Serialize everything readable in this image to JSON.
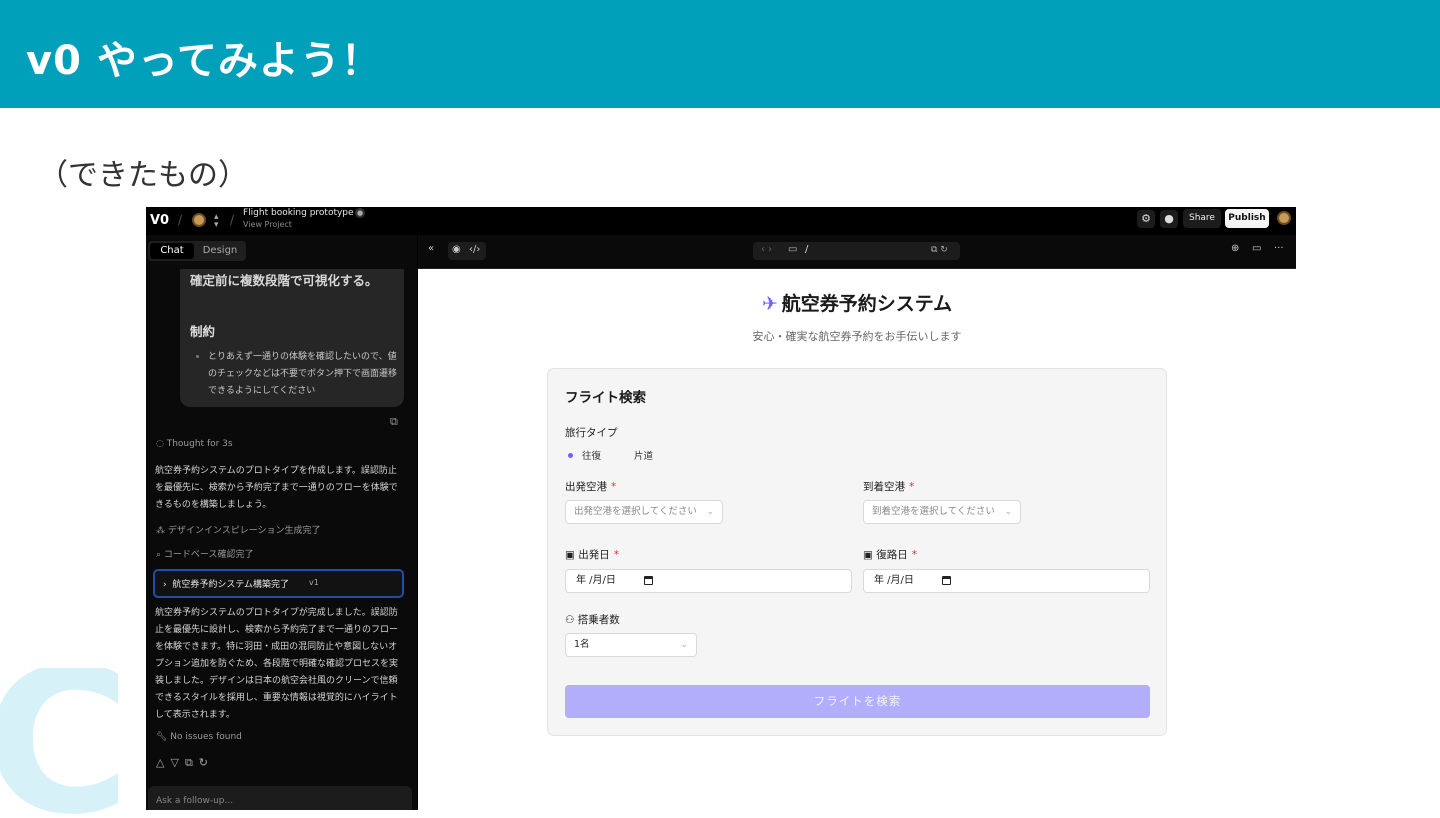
{
  "slide": {
    "title": "v0 やってみよう！",
    "subtitle": "（できたもの）",
    "bg_logo": "C"
  },
  "topbar": {
    "logo": "V0",
    "project_title": "Flight booking prototype",
    "project_link": "View Project",
    "share_label": "Share",
    "publish_label": "Publish",
    "icons": [
      "settings-icon",
      "github-icon"
    ]
  },
  "chat": {
    "tabs": [
      "Chat",
      "Design"
    ],
    "bubble": {
      "heading_tail": "確定前に複数段階で可視化する。",
      "constraints_heading": "制約",
      "constraint_item": "とりあえず一通りの体験を確認したいので、値のチェックなどは不要でボタン押下で画面遷移できるようにしてください"
    },
    "thought": "Thought for 3s",
    "intro": "航空券予約システムのプロトタイプを作成します。誤認防止を最優先に、検索から予約完了まで一通りのフローを体験できるものを構築しましょう。",
    "steps": [
      "デザインインスピレーション生成完了",
      "コードベース確認完了"
    ],
    "version_label": "航空券予約システム構築完了",
    "version_badge": "v1",
    "summary": "航空券予約システムのプロトタイプが完成しました。誤認防止を最優先に設計し、検索から予約完了まで一通りのフローを体験できます。特に羽田・成田の混同防止や意図しないオプション追加を防ぐため、各段階で明確な確認プロセスを実装しました。デザインは日本の航空会社風のクリーンで信頼できるスタイルを採用し、重要な情報は視覚的にハイライトして表示されます。",
    "no_issues": "No issues found",
    "followup_placeholder": "Ask a follow-up..."
  },
  "preview": {
    "url_path": "/"
  },
  "app": {
    "title": "航空券予約システム",
    "subtitle": "安心・確実な航空券予約をお手伝いします",
    "card_title": "フライト検索",
    "trip_type_label": "旅行タイプ",
    "trip_options": [
      "往復",
      "片道"
    ],
    "selected_trip": "往復",
    "departure_airport_label": "出発空港",
    "departure_airport_placeholder": "出発空港を選択してください",
    "arrival_airport_label": "到着空港",
    "arrival_airport_placeholder": "到着空港を選択してください",
    "departure_date_label": "出発日",
    "return_date_label": "復路日",
    "date_placeholder": "年 /月/日",
    "passengers_label": "搭乗者数",
    "passengers_value": "1名",
    "required_mark": "*",
    "search_button": "フライトを検索",
    "accent_color": "#6c63ff"
  },
  "colors": {
    "header": "#00a0bb",
    "version_border": "#1e4fa8",
    "button_disabled": "#b3aefb"
  }
}
